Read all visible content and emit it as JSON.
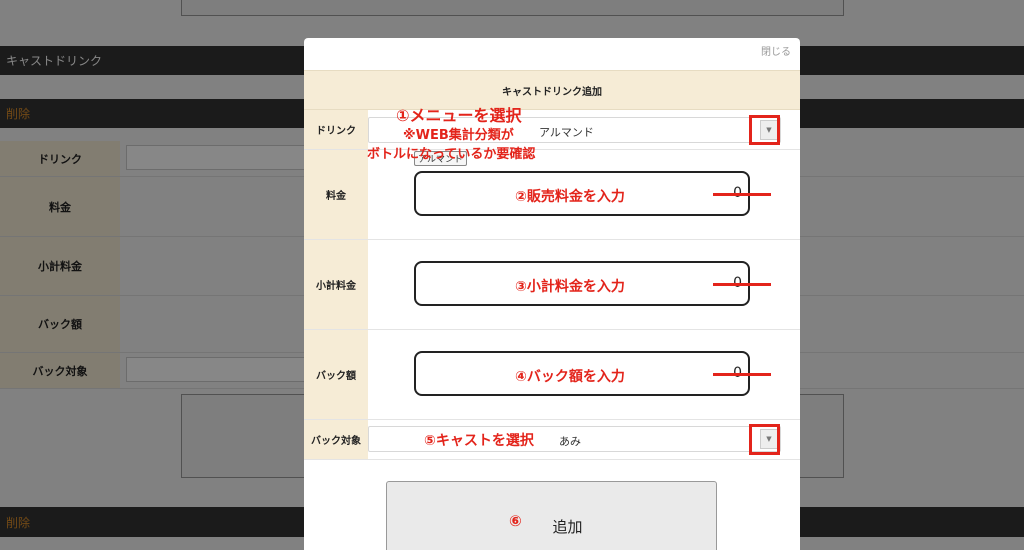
{
  "background": {
    "section_title": "キャストドリンク",
    "delete_label": "削除",
    "delete_label_2": "削除",
    "rows": [
      {
        "label": "ドリンク"
      },
      {
        "label": "料金"
      },
      {
        "label": "小計料金"
      },
      {
        "label": "バック額"
      },
      {
        "label": "バック対象"
      }
    ]
  },
  "modal": {
    "close_label": "閉じる",
    "title": "キャストドリンク追加",
    "drink": {
      "label": "ドリンク",
      "selected": "アルマンド",
      "tag": "アルマンド"
    },
    "price": {
      "label": "料金",
      "value": "0"
    },
    "subtotal": {
      "label": "小計料金",
      "value": "0"
    },
    "back_amount": {
      "label": "バック額",
      "value": "0"
    },
    "back_target": {
      "label": "バック対象",
      "selected": "あみ"
    },
    "add_button": "追加"
  },
  "annotations": {
    "step1": "①メニューを選択",
    "note1": "※WEB集計分類が",
    "note2": "ボトルになっているか要確認",
    "step2": "②販売料金を入力",
    "step3": "③小計料金を入力",
    "step4": "④バック額を入力",
    "step5": "⑤キャストを選択",
    "step6": "⑥"
  },
  "colors": {
    "annotation_red": "#e3241b",
    "label_bg": "#f6ecd6",
    "delete_orange": "#d98c2a",
    "dark_bar": "#333333"
  }
}
